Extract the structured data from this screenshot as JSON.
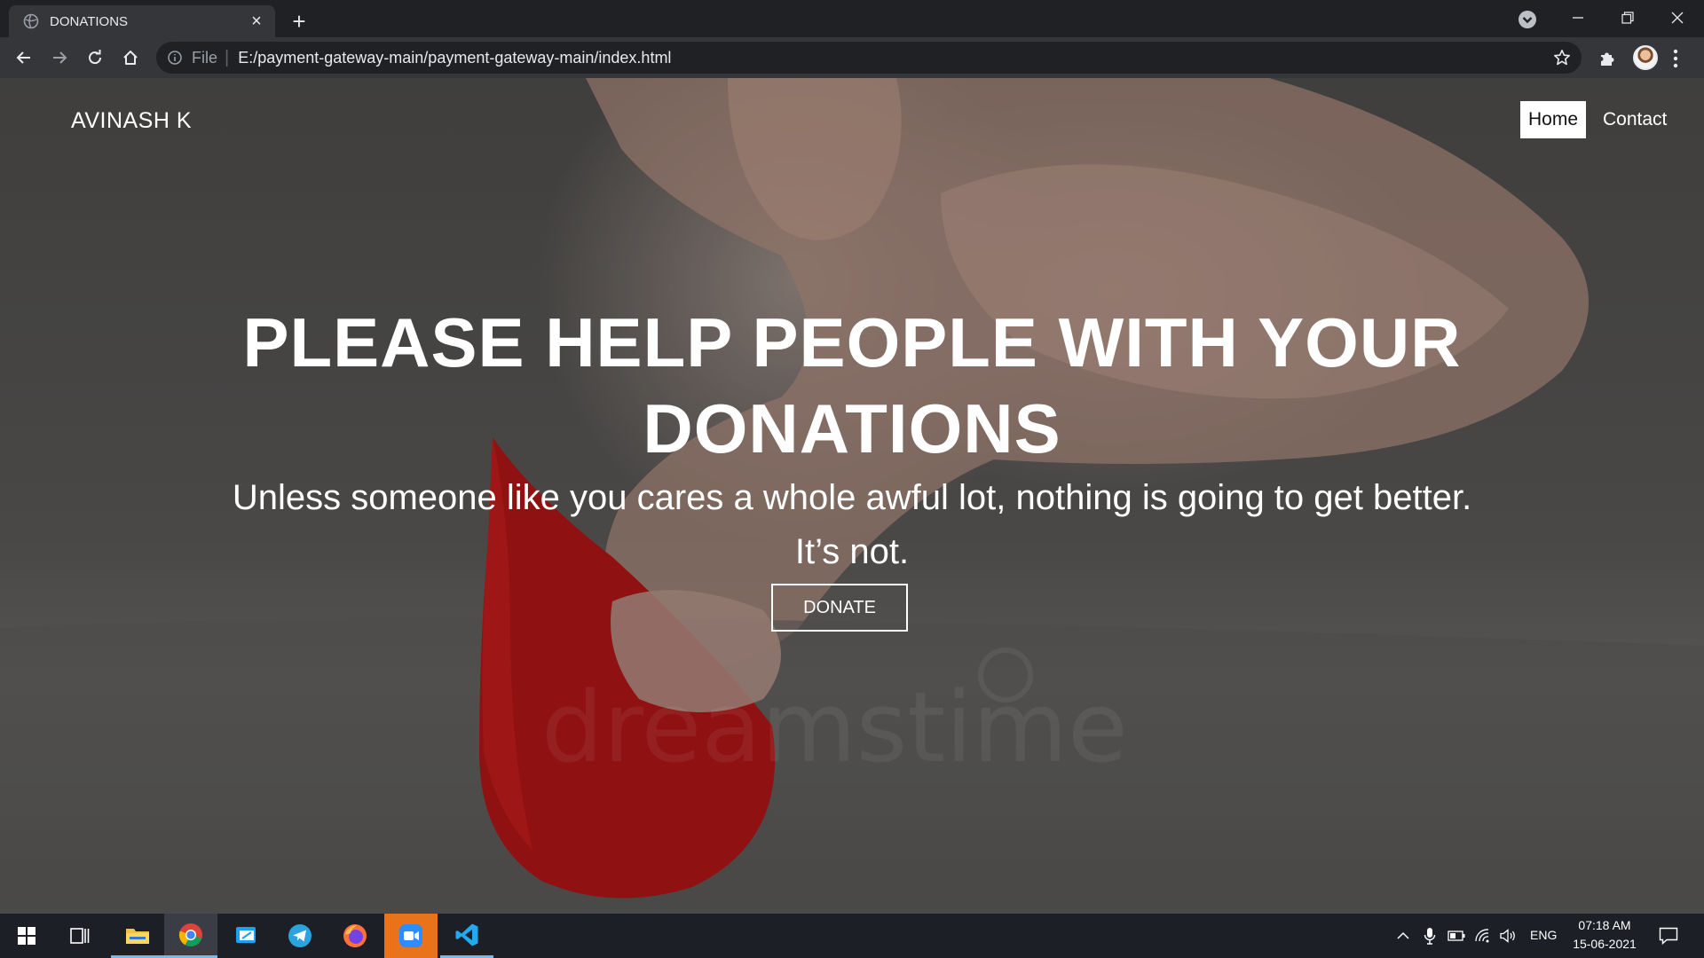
{
  "browser": {
    "tab": {
      "title": "DONATIONS",
      "close_glyph": "×"
    },
    "new_tab_glyph": "+",
    "address_bar": {
      "scheme_label": "File",
      "separator": "|",
      "url": "E:/payment-gateway-main/payment-gateway-main/index.html"
    }
  },
  "page": {
    "brand": "AVINASH K",
    "nav": {
      "home": "Home",
      "contact": "Contact"
    },
    "hero": {
      "title": "PLEASE HELP PEOPLE WITH YOUR DONATIONS",
      "subtitle": "Unless someone like you cares a whole awful lot, nothing is going to get better. It’s not.",
      "button": "DONATE"
    },
    "watermark": "dreamstime"
  },
  "taskbar": {
    "apps": [
      "start-icon",
      "task-view-icon",
      "file-explorer-icon",
      "chrome-icon",
      "whiteboard-icon",
      "telegram-icon",
      "firefox-icon",
      "zoom-icon",
      "vscode-icon"
    ],
    "tray": {
      "language": "ENG",
      "time": "07:18 AM",
      "date": "15-06-2021"
    }
  },
  "colors": {
    "chrome_dark": "#202124",
    "chrome_toolbar": "#35363a",
    "taskbar": "#1c1f26",
    "drop_red": "#b01515",
    "taskbar_accent": "#76b9ed",
    "zoom_orange": "#e8731a"
  }
}
